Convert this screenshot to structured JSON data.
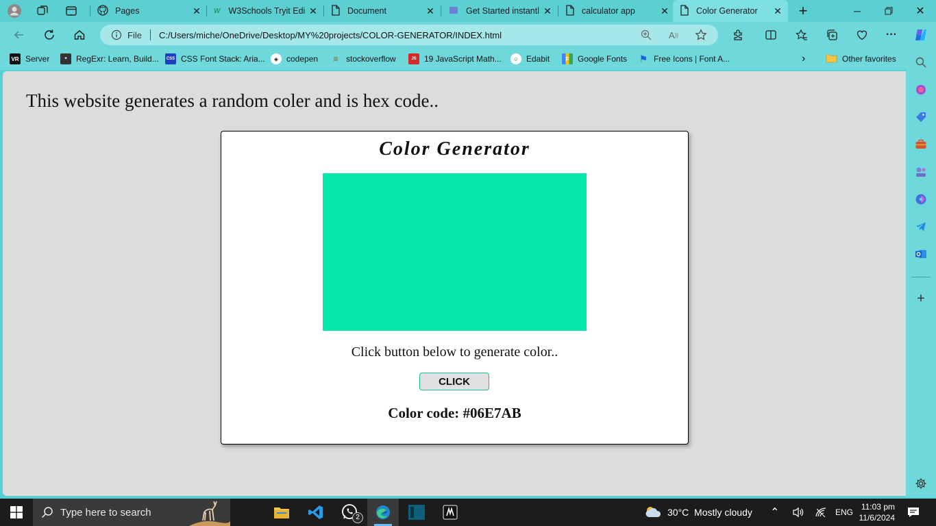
{
  "browser": {
    "tabs": [
      {
        "label": "Pages",
        "icon": "github-icon"
      },
      {
        "label": "W3Schools Tryit Edi",
        "icon": "w3schools-icon"
      },
      {
        "label": "Document",
        "icon": "document-icon"
      },
      {
        "label": "Get Started instantl",
        "icon": "loading-icon"
      },
      {
        "label": "calculator app",
        "icon": "document-icon"
      },
      {
        "label": "Color Generator",
        "icon": "document-icon",
        "active": true
      }
    ],
    "address": {
      "scheme_label": "File",
      "url": "C:/Users/miche/OneDrive/Desktop/MY%20projects/COLOR-GENERATOR/INDEX.html"
    },
    "favorites": [
      {
        "label": "Server",
        "icon": "vr-icon"
      },
      {
        "label": "RegExr: Learn, Build...",
        "icon": "regexr-icon"
      },
      {
        "label": "CSS Font Stack: Aria...",
        "icon": "cssfont-icon"
      },
      {
        "label": "codepen",
        "icon": "codepen-icon"
      },
      {
        "label": "stockoverflow",
        "icon": "stackoverflow-icon"
      },
      {
        "label": "19 JavaScript Math...",
        "icon": "js-math-icon"
      },
      {
        "label": "Edabit",
        "icon": "edabit-icon"
      },
      {
        "label": "Google Fonts",
        "icon": "google-fonts-icon"
      },
      {
        "label": "Free Icons | Font A...",
        "icon": "fontawesome-icon"
      }
    ],
    "other_favorites": "Other favorites"
  },
  "page": {
    "intro": "This website generates a random coler and is hex code..",
    "title": "Color Generator",
    "swatch_color": "#06E7AB",
    "instruction": "Click button below to generate color..",
    "button_label": "CLICK",
    "color_code_text": "Color code: #06E7AB"
  },
  "taskbar": {
    "search_placeholder": "Type here to search",
    "weather": "30°C  Mostly cloudy",
    "language": "ENG",
    "time": "11:03 pm",
    "date": "11/6/2024",
    "whatsapp_badge": "2"
  },
  "colors": {
    "chrome": "#5ccfd2",
    "page_bg": "#dcdcdc",
    "accent": "#06E7AB"
  }
}
